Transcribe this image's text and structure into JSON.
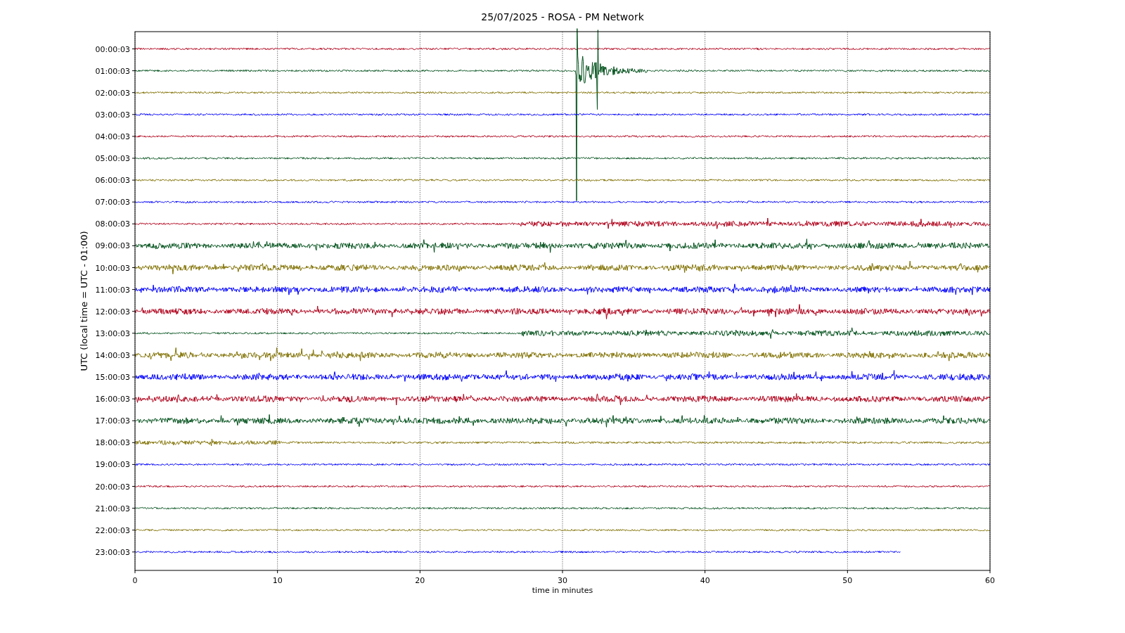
{
  "title": "25/07/2025 - ROSA - PM Network",
  "ylabel": "UTC (local time = UTC - 01:00)",
  "xlabel": "time in minutes",
  "xticks": [
    "0",
    "10",
    "20",
    "30",
    "40",
    "50",
    "60"
  ],
  "traces": [
    {
      "label": "00:00:03",
      "color": "#b0001a",
      "kind": "quiet",
      "level": 1
    },
    {
      "label": "01:00:03",
      "color": "#00501a",
      "kind": "event",
      "level": 1
    },
    {
      "label": "02:00:03",
      "color": "#807000",
      "kind": "quiet",
      "level": 1
    },
    {
      "label": "03:00:03",
      "color": "#0000ff",
      "kind": "quiet",
      "level": 1
    },
    {
      "label": "04:00:03",
      "color": "#b0001a",
      "kind": "quiet",
      "level": 1
    },
    {
      "label": "05:00:03",
      "color": "#00501a",
      "kind": "quiet",
      "level": 1
    },
    {
      "label": "06:00:03",
      "color": "#807000",
      "kind": "quiet",
      "level": 1
    },
    {
      "label": "07:00:03",
      "color": "#0000ff",
      "kind": "quiet",
      "level": 1
    },
    {
      "label": "08:00:03",
      "color": "#b0001a",
      "kind": "late",
      "level": 1
    },
    {
      "label": "09:00:03",
      "color": "#00501a",
      "kind": "noisy",
      "level": 1
    },
    {
      "label": "10:00:03",
      "color": "#807000",
      "kind": "noisy",
      "level": 1
    },
    {
      "label": "11:00:03",
      "color": "#0000ff",
      "kind": "noisy",
      "level": 1
    },
    {
      "label": "12:00:03",
      "color": "#b0001a",
      "kind": "noisy",
      "level": 1
    },
    {
      "label": "13:00:03",
      "color": "#00501a",
      "kind": "late",
      "level": 1
    },
    {
      "label": "14:00:03",
      "color": "#807000",
      "kind": "noisy",
      "level": 1
    },
    {
      "label": "15:00:03",
      "color": "#0000ff",
      "kind": "noisy",
      "level": 1
    },
    {
      "label": "16:00:03",
      "color": "#b0001a",
      "kind": "noisy",
      "level": 1
    },
    {
      "label": "17:00:03",
      "color": "#00501a",
      "kind": "noisy",
      "level": 1
    },
    {
      "label": "18:00:03",
      "color": "#807000",
      "kind": "early",
      "level": 1
    },
    {
      "label": "19:00:03",
      "color": "#0000ff",
      "kind": "quiet",
      "level": 1
    },
    {
      "label": "20:00:03",
      "color": "#b0001a",
      "kind": "quiet",
      "level": 1
    },
    {
      "label": "21:00:03",
      "color": "#00501a",
      "kind": "quiet",
      "level": 1
    },
    {
      "label": "22:00:03",
      "color": "#807000",
      "kind": "quiet",
      "level": 1
    },
    {
      "label": "23:00:03",
      "color": "#0000ff",
      "kind": "quiet",
      "level": 0.895
    }
  ]
}
